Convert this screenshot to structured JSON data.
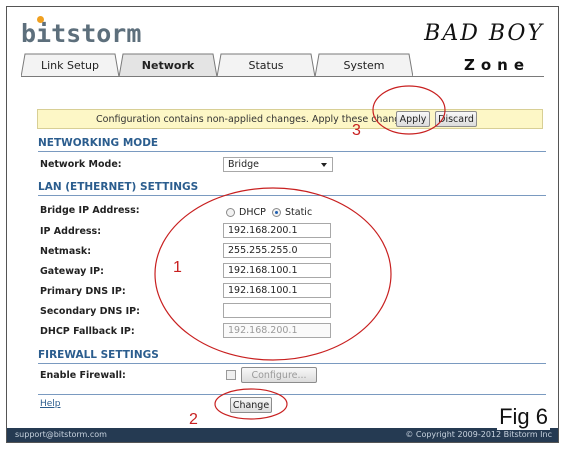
{
  "header": {
    "logo_text": "bitstorm",
    "brand_line1": "BAD BOY",
    "brand_line2": "Zone"
  },
  "tabs": [
    {
      "label": "Link Setup",
      "active": false
    },
    {
      "label": "Network",
      "active": true
    },
    {
      "label": "Status",
      "active": false
    },
    {
      "label": "System",
      "active": false
    }
  ],
  "notice": {
    "text": "Configuration contains non-applied changes. Apply these changes?",
    "apply_label": "Apply",
    "discard_label": "Discard"
  },
  "networking_mode": {
    "title": "NETWORKING MODE",
    "network_mode_label": "Network Mode:",
    "network_mode_value": "Bridge"
  },
  "lan": {
    "title": "LAN (ETHERNET) SETTINGS",
    "bridge_ip_label": "Bridge IP Address:",
    "dhcp_label": "DHCP",
    "static_label": "Static",
    "selected_mode": "Static",
    "ip_address_label": "IP Address:",
    "ip_address": "192.168.200.1",
    "netmask_label": "Netmask:",
    "netmask": "255.255.255.0",
    "gateway_label": "Gateway IP:",
    "gateway": "192.168.100.1",
    "primary_dns_label": "Primary DNS IP:",
    "primary_dns": "192.168.100.1",
    "secondary_dns_label": "Secondary DNS IP:",
    "secondary_dns": "",
    "dhcp_fallback_label": "DHCP Fallback IP:",
    "dhcp_fallback": "192.168.200.1"
  },
  "firewall": {
    "title": "FIREWALL SETTINGS",
    "enable_label": "Enable Firewall:",
    "enabled": false,
    "configure_label": "Configure..."
  },
  "actions": {
    "help_label": "Help",
    "change_label": "Change"
  },
  "footer": {
    "left": "support@bitstorm.com",
    "right": "© Copyright 2009-2012 Bitstorm Inc"
  },
  "annotations": {
    "n1": "1",
    "n2": "2",
    "n3": "3",
    "fig_label": "Fig 6",
    "color": "#c82020"
  }
}
